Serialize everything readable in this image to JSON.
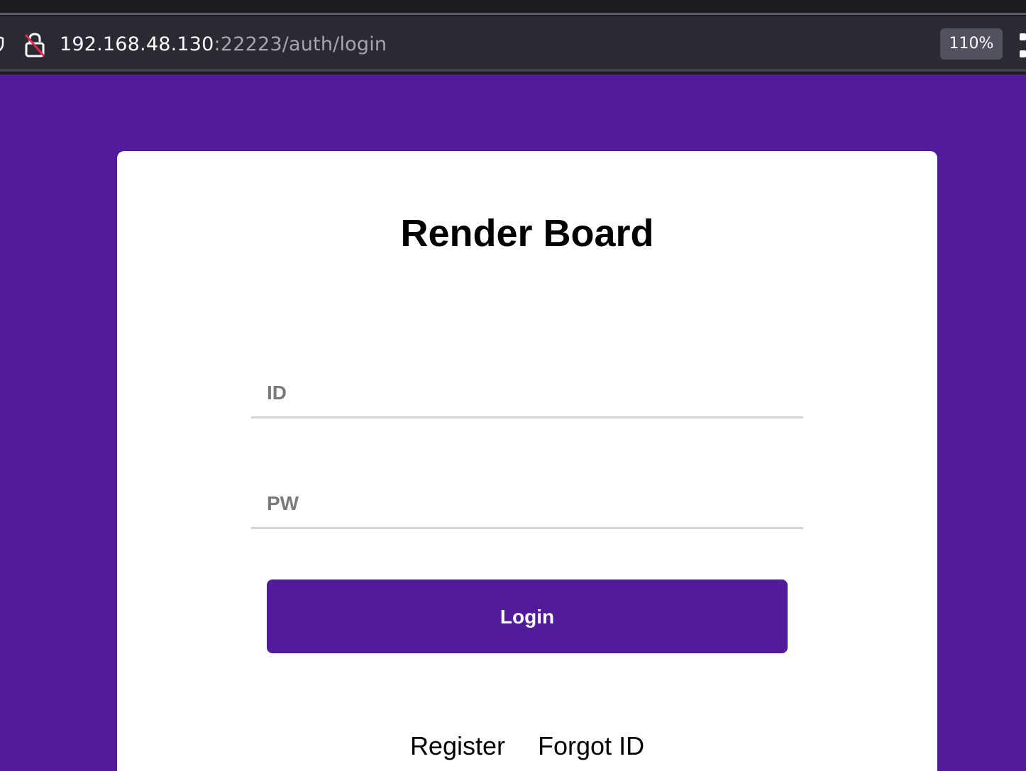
{
  "browser": {
    "url_host": "192.168.48.130",
    "url_rest": ":22223/auth/login",
    "zoom": "110%",
    "icons": [
      "shield-icon",
      "insecure-lock-icon",
      "menu-icon"
    ]
  },
  "page": {
    "background_color": "#521b9c",
    "title": "Render Board",
    "id_placeholder": "ID",
    "pw_placeholder": "PW",
    "login_label": "Login",
    "register_label": "Register",
    "forgot_id_label": "Forgot ID"
  }
}
